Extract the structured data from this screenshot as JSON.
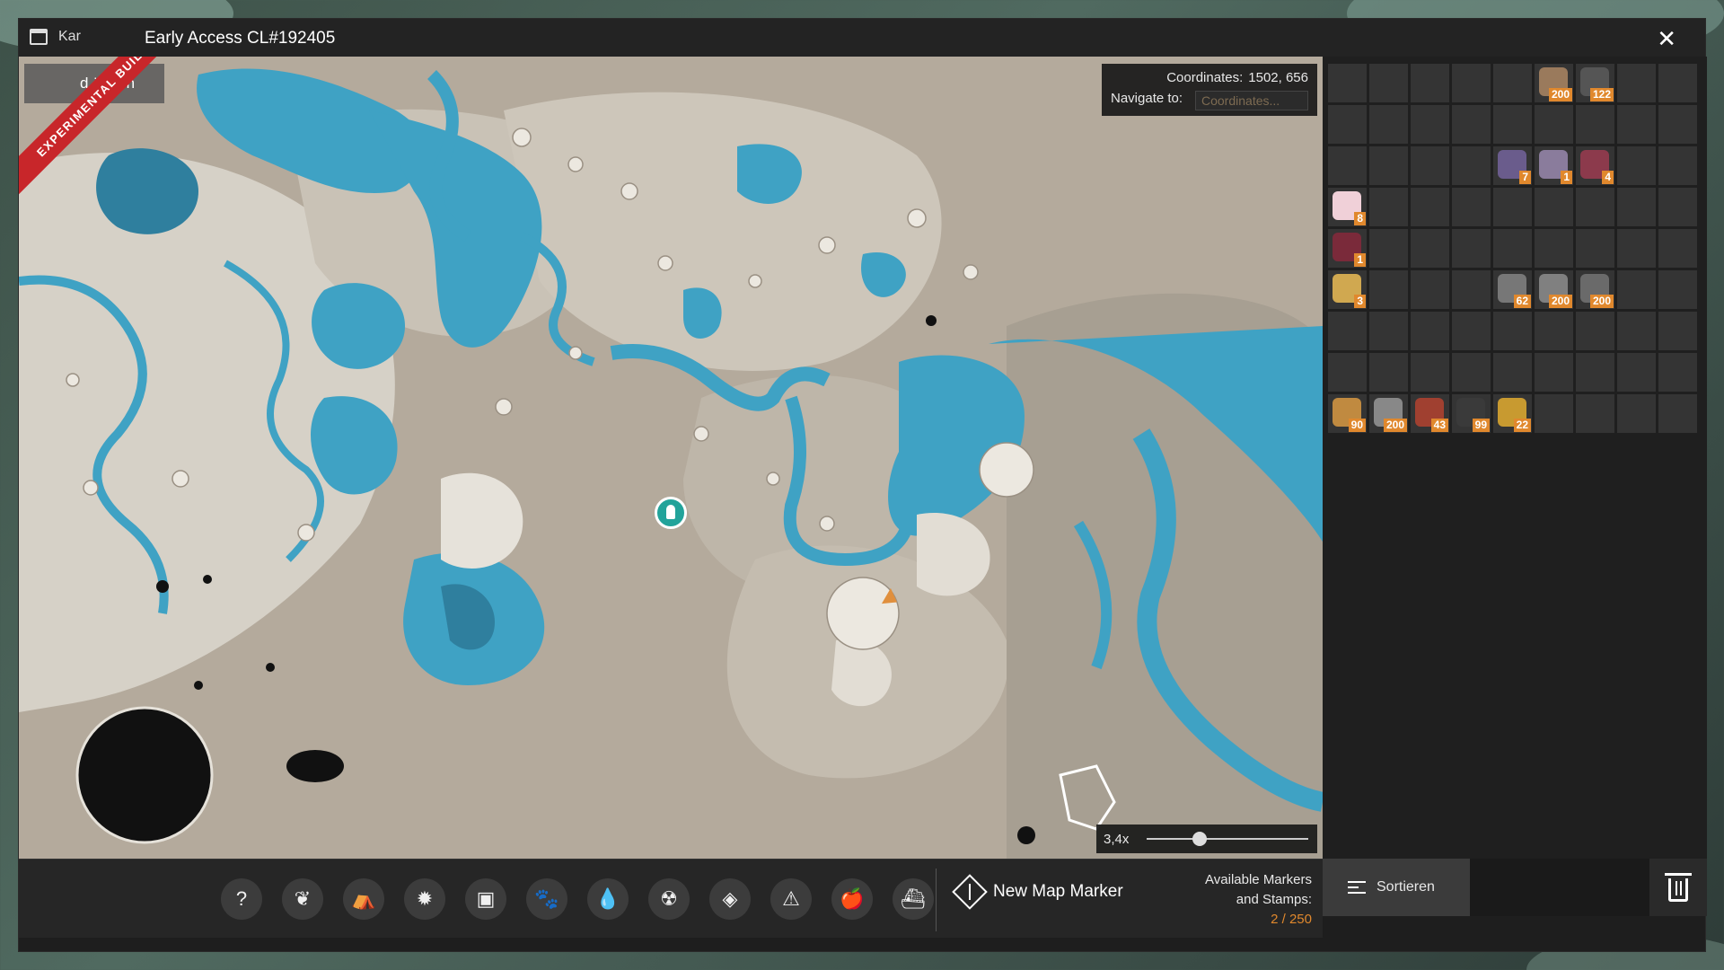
{
  "window": {
    "title_short": "Kar",
    "title": "Early Access CL#192405",
    "close_glyph": "✕",
    "experimental_ribbon": "EXPERIMENTAL BUILD"
  },
  "map": {
    "open_button_label": "d öffnen",
    "coordinates_label": "Coordinates:",
    "coordinates_value": "1502, 656",
    "navigate_label": "Navigate to:",
    "navigate_placeholder": "Coordinates...",
    "zoom_label": "3,4x",
    "zoom_level_fraction": 0.33,
    "colors": {
      "land": "#b4aa9c",
      "water": "#3fa2c4",
      "deep_water": "#2f7f9e",
      "highlight": "#e6e2da"
    }
  },
  "toolbar": {
    "stamps": [
      {
        "icon": "question-icon",
        "glyph": "?"
      },
      {
        "icon": "leaf-icon",
        "glyph": "❦"
      },
      {
        "icon": "camp-icon",
        "glyph": "⛺"
      },
      {
        "icon": "bug-icon",
        "glyph": "✹"
      },
      {
        "icon": "chest-icon",
        "glyph": "▣"
      },
      {
        "icon": "paw-icon",
        "glyph": "🐾"
      },
      {
        "icon": "water-drop-icon",
        "glyph": "💧"
      },
      {
        "icon": "radiation-icon",
        "glyph": "☢"
      },
      {
        "icon": "crystal-icon",
        "glyph": "◈"
      },
      {
        "icon": "warning-icon",
        "glyph": "⚠"
      },
      {
        "icon": "food-icon",
        "glyph": "🍎"
      },
      {
        "icon": "wreck-icon",
        "glyph": "⛴"
      }
    ],
    "new_marker_label": "New Map Marker",
    "available_line1": "Available Markers",
    "available_line2": "and Stamps:",
    "available_count": "2 / 250"
  },
  "inventory": {
    "accent": "#e0882d",
    "rows": [
      [
        null,
        null,
        null,
        null,
        null,
        {
          "qty": "200",
          "color": "#9a7a5c"
        },
        {
          "qty": "122",
          "color": "#555"
        },
        null,
        null
      ],
      [
        null,
        null,
        null,
        null,
        null,
        null,
        null,
        null,
        null
      ],
      [
        null,
        null,
        null,
        null,
        {
          "qty": "7",
          "color": "#6a5c8c"
        },
        {
          "qty": "1",
          "color": "#8a7c9c"
        },
        {
          "qty": "4",
          "color": "#8c3a4c"
        },
        null,
        null
      ],
      [
        {
          "qty": "8",
          "color": "#f0d0d8"
        },
        null,
        null,
        null,
        null,
        null,
        null,
        null,
        null
      ],
      [
        {
          "qty": "1",
          "color": "#7a2a3a"
        },
        null,
        null,
        null,
        null,
        null,
        null,
        null,
        null
      ],
      [
        {
          "qty": "3",
          "color": "#d0a850"
        },
        null,
        null,
        null,
        {
          "qty": "62",
          "color": "#777"
        },
        {
          "qty": "200",
          "color": "#808080"
        },
        {
          "qty": "200",
          "color": "#6a6a6a"
        },
        null,
        null
      ],
      [
        null,
        null,
        null,
        null,
        null,
        null,
        null,
        null,
        null
      ],
      [
        null,
        null,
        null,
        null,
        null,
        null,
        null,
        null,
        null
      ],
      [
        {
          "qty": "90",
          "color": "#c08a40"
        },
        {
          "qty": "200",
          "color": "#888"
        },
        {
          "qty": "43",
          "color": "#a04030"
        },
        {
          "qty": "99",
          "color": "#3a3a3a"
        },
        {
          "qty": "22",
          "color": "#c89a30"
        },
        null,
        null,
        null,
        null
      ]
    ],
    "sort_label": "Sortieren"
  }
}
